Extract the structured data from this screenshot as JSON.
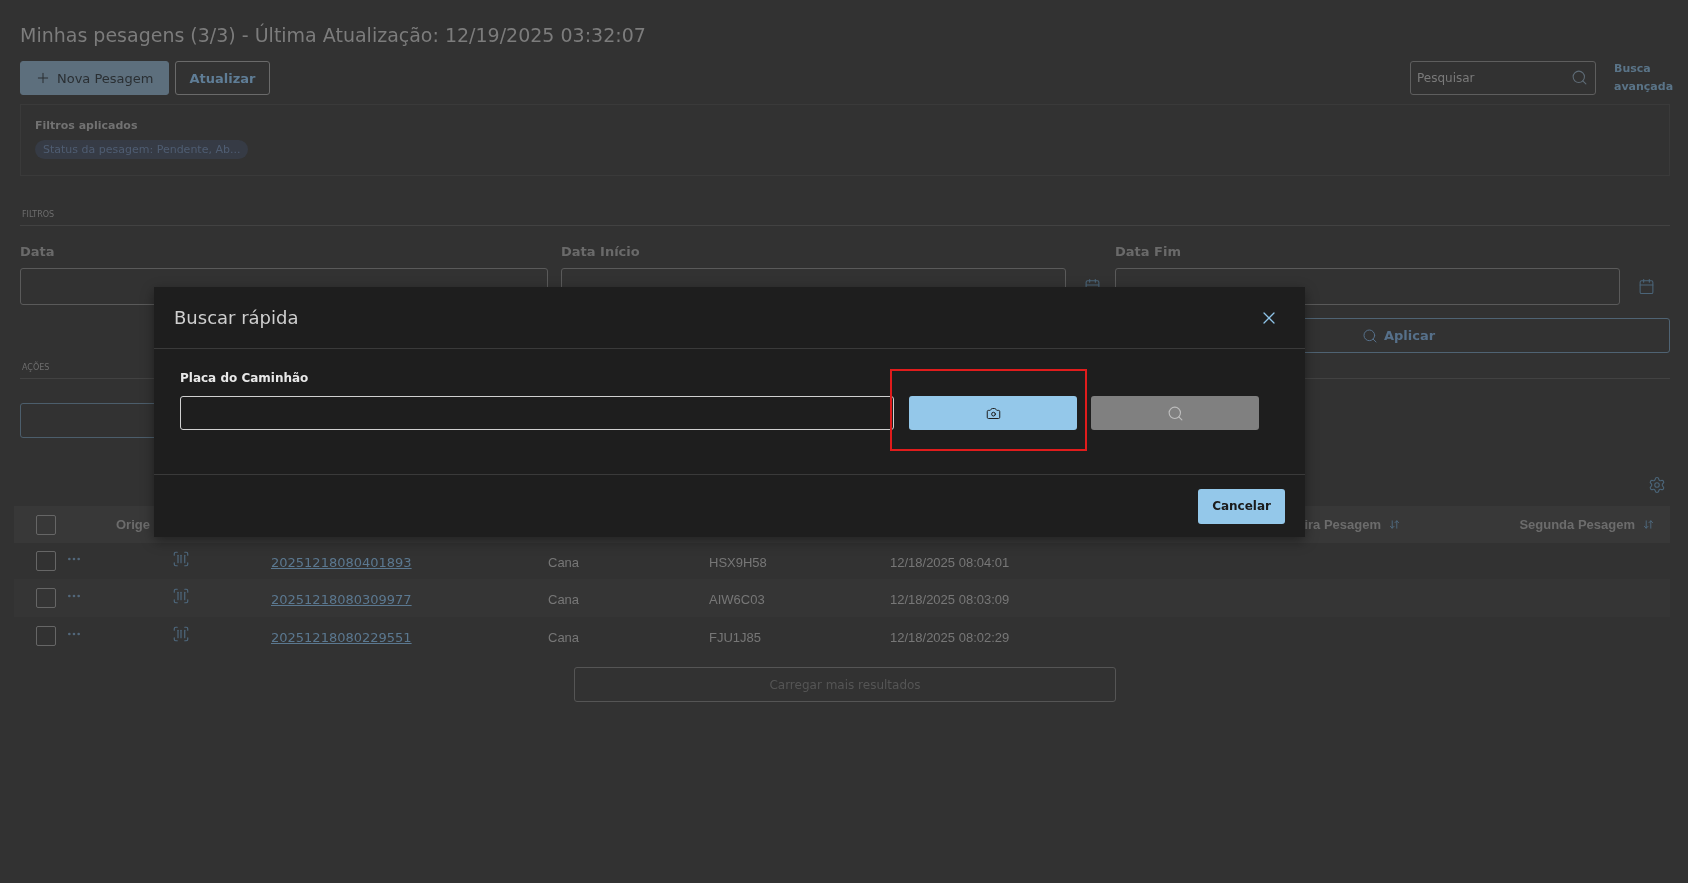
{
  "page": {
    "title": "Minhas pesagens (3/3) - Última Atualização: 12/19/2025 03:32:07",
    "buttons": [
      {
        "label": "Nova Pesagem",
        "kind": "primary"
      },
      {
        "label": "Atualizar",
        "kind": "outline"
      }
    ],
    "search": {
      "placeholder": "Pesquisar"
    },
    "advanced_search_link": "Busca avançada"
  },
  "applied_filters": {
    "title": "Filtros aplicados",
    "chips": [
      "Status da pesagem: Pendente, Ab..."
    ]
  },
  "filters": {
    "section": "FILTROS",
    "fields": [
      {
        "label": "Data",
        "calendar": false
      },
      {
        "label": "Data Início",
        "calendar": true
      },
      {
        "label": "Data Fim",
        "calendar": true
      }
    ],
    "apply_button": "Aplicar"
  },
  "actions": {
    "section": "AÇÕES"
  },
  "table": {
    "all_checked": false,
    "columns": [
      {
        "label": "Orige",
        "sortable": false
      },
      {
        "label": "ira Pesagem",
        "sortable": true
      },
      {
        "label": "Segunda Pesagem",
        "sortable": true
      }
    ],
    "rows": [
      {
        "checked": false,
        "code": "20251218080401893",
        "product": "Cana",
        "plate": "HSX9H58",
        "date": "12/18/2025 08:04:01"
      },
      {
        "checked": false,
        "code": "20251218080309977",
        "product": "Cana",
        "plate": "AIW6C03",
        "date": "12/18/2025 08:03:09"
      },
      {
        "checked": false,
        "code": "20251218080229551",
        "product": "Cana",
        "plate": "FJU1J85",
        "date": "12/18/2025 08:02:29"
      }
    ],
    "load_more": "Carregar mais resultados"
  },
  "modal": {
    "title": "Buscar rápida",
    "field_label": "Placa do Caminhão",
    "camera_button": {
      "highlighted": true
    },
    "search_button": {
      "disabled": true
    },
    "cancel_button": "Cancelar"
  }
}
